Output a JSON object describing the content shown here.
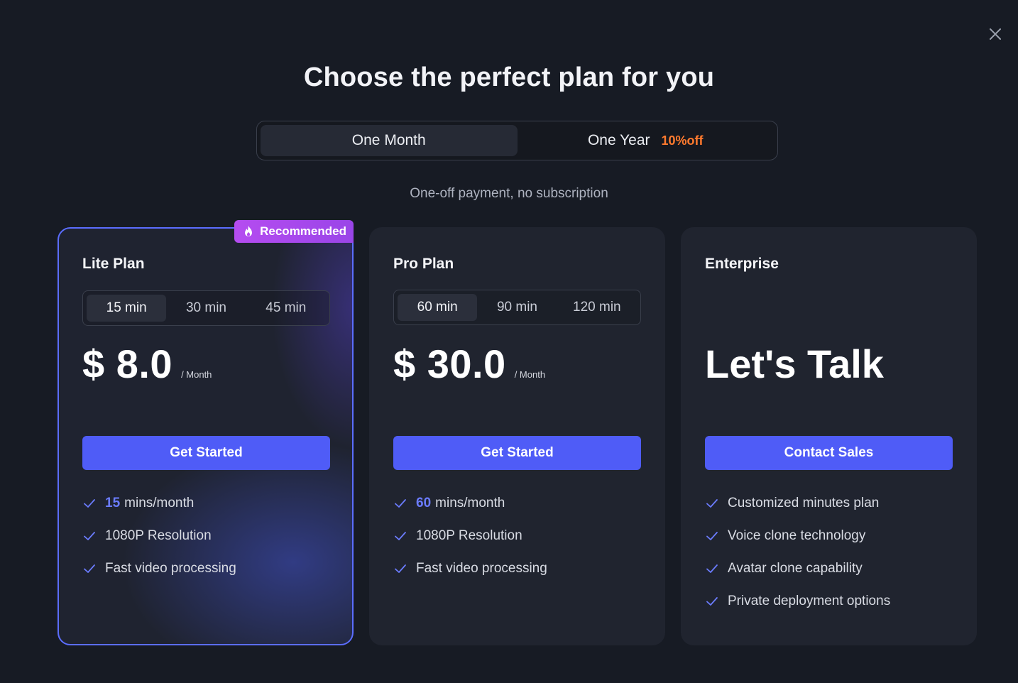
{
  "title": "Choose the perfect plan for you",
  "billing": {
    "month_label": "One Month",
    "year_label": "One Year",
    "year_discount": "10%off",
    "active": "month"
  },
  "subtitle": "One-off payment, no subscription",
  "colors": {
    "accent": "#4f5cf7",
    "badge": "#b54cf0",
    "discount": "#ff7a2e",
    "highlight": "#6b7cff",
    "background": "#171b24",
    "card": "#20242f"
  },
  "plans": {
    "lite": {
      "badge": "Recommended",
      "badge_icon": "flame-icon",
      "name": "Lite Plan",
      "options": [
        "15 min",
        "30 min",
        "45 min"
      ],
      "selected_option": "15 min",
      "price": "$ 8.0",
      "per": "/ Month",
      "cta": "Get Started",
      "features": [
        {
          "highlight": "15",
          "text": "mins/month"
        },
        {
          "highlight": "",
          "text": "1080P Resolution"
        },
        {
          "highlight": "",
          "text": "Fast video processing"
        }
      ]
    },
    "pro": {
      "name": "Pro Plan",
      "options": [
        "60 min",
        "90 min",
        "120 min"
      ],
      "selected_option": "60 min",
      "price": "$ 30.0",
      "per": "/ Month",
      "cta": "Get Started",
      "features": [
        {
          "highlight": "60",
          "text": "mins/month"
        },
        {
          "highlight": "",
          "text": "1080P Resolution"
        },
        {
          "highlight": "",
          "text": "Fast video processing"
        }
      ]
    },
    "enterprise": {
      "name": "Enterprise",
      "headline": "Let's Talk",
      "cta": "Contact Sales",
      "features": [
        {
          "highlight": "",
          "text": "Customized minutes plan"
        },
        {
          "highlight": "",
          "text": "Voice clone technology"
        },
        {
          "highlight": "",
          "text": "Avatar clone capability"
        },
        {
          "highlight": "",
          "text": "Private deployment options"
        }
      ]
    }
  }
}
